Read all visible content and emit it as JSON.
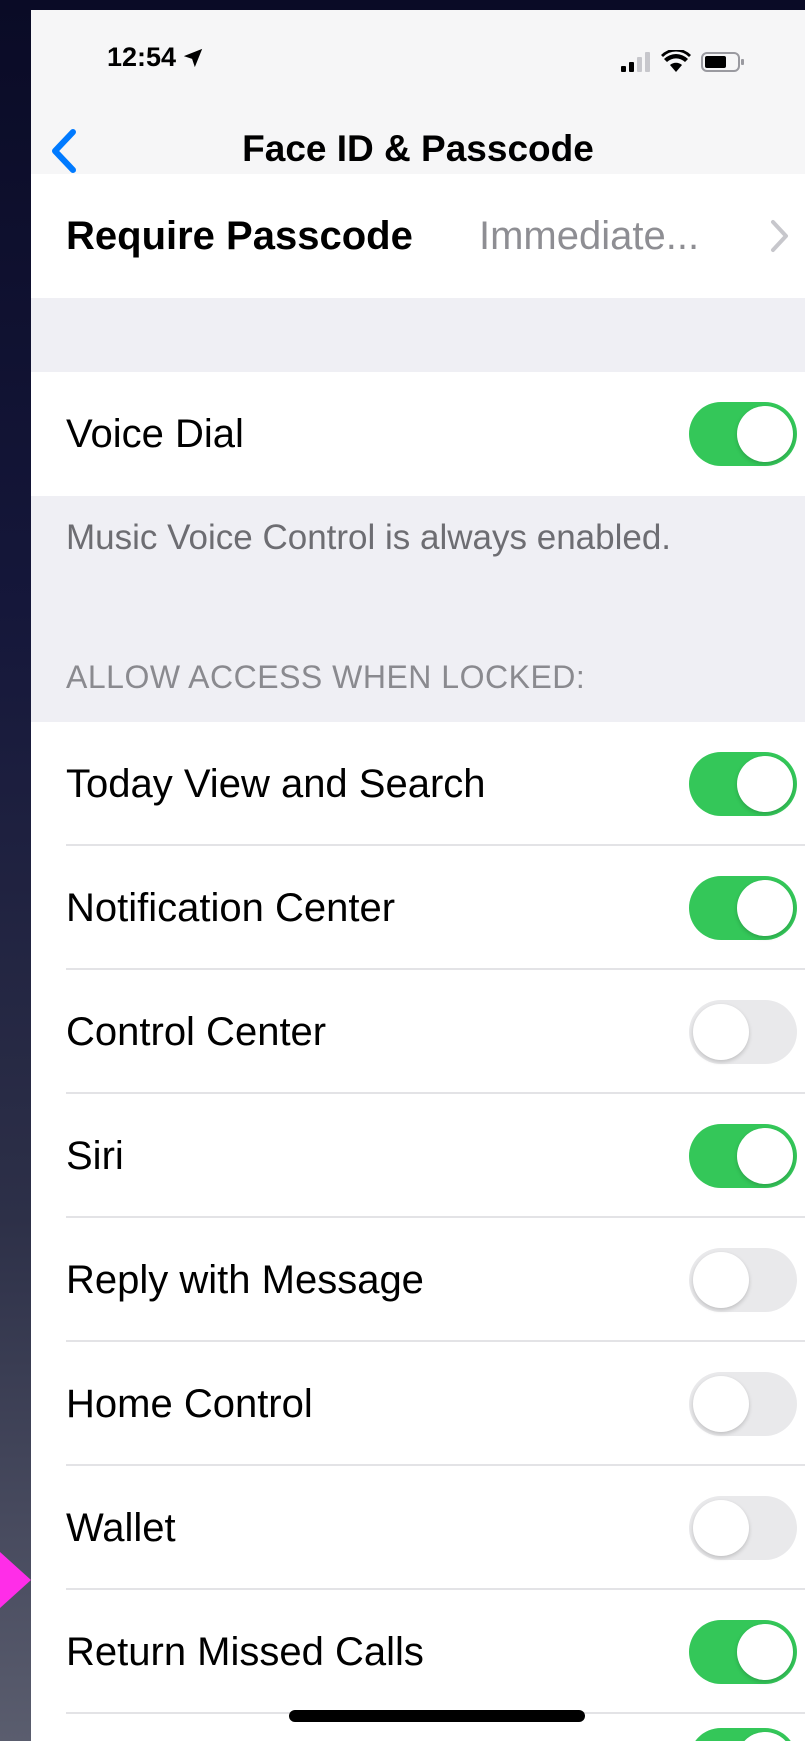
{
  "status_bar": {
    "time": "12:54",
    "icons": [
      "location-arrow-icon",
      "signal-icon",
      "wifi-icon",
      "battery-icon"
    ]
  },
  "nav": {
    "title": "Face ID & Passcode",
    "back_icon": "chevron-left-icon"
  },
  "require_passcode": {
    "label": "Require Passcode",
    "value": "Immediate...",
    "chevron_icon": "chevron-right-icon"
  },
  "voice_dial": {
    "label": "Voice Dial",
    "on": true,
    "footer": "Music Voice Control is always enabled."
  },
  "locked_access": {
    "header": "ALLOW ACCESS WHEN LOCKED:",
    "items": [
      {
        "label": "Today View and Search",
        "on": true
      },
      {
        "label": "Notification Center",
        "on": true
      },
      {
        "label": "Control Center",
        "on": false
      },
      {
        "label": "Siri",
        "on": true
      },
      {
        "label": "Reply with Message",
        "on": false
      },
      {
        "label": "Home Control",
        "on": false
      },
      {
        "label": "Wallet",
        "on": false
      },
      {
        "label": "Return Missed Calls",
        "on": true
      }
    ]
  },
  "colors": {
    "toggle_on": "#34c759",
    "toggle_off": "#e9e9eb",
    "accent_blue": "#007aff",
    "marker": "#ff2de8"
  }
}
